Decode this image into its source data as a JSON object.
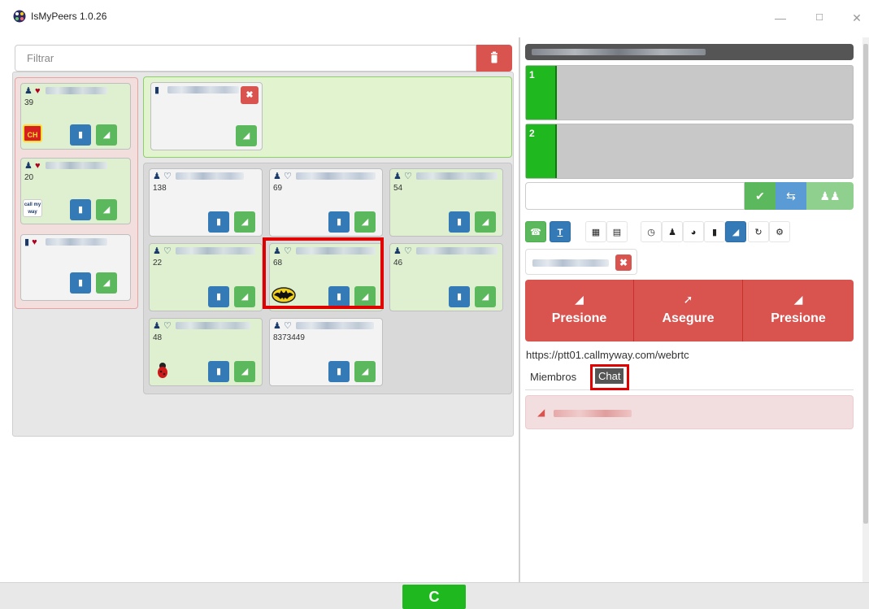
{
  "window": {
    "title": "IsMyPeers 1.0.26",
    "minimize_glyph": "—",
    "maximize_glyph": "☐",
    "close_glyph": "✕"
  },
  "filter": {
    "placeholder": "Filtrar"
  },
  "red_group": {
    "cards": [
      {
        "count": "39",
        "avatar": "CH"
      },
      {
        "count": "20",
        "avatar": "call my way"
      },
      {
        "count": ""
      }
    ]
  },
  "gray_group": {
    "cards": [
      {
        "count": "138"
      },
      {
        "count": "69"
      },
      {
        "count": "54"
      },
      {
        "count": "22"
      },
      {
        "count": "68"
      },
      {
        "count": "46"
      },
      {
        "count": "48"
      },
      {
        "count": "8373449"
      }
    ]
  },
  "channels": [
    {
      "number": "1"
    },
    {
      "number": "2"
    }
  ],
  "press_buttons": [
    {
      "label": "Presione"
    },
    {
      "label": "Asegure"
    },
    {
      "label": "Presione"
    }
  ],
  "url": "https://ptt01.callmyway.com/webrtc",
  "tabs": {
    "members": "Miembros",
    "chat": "Chat"
  },
  "refresh_glyph": "C",
  "colors": {
    "danger": "#d9534f",
    "primary": "#337ab7",
    "success": "#5cb85c",
    "channel_green": "#1fb81f"
  }
}
